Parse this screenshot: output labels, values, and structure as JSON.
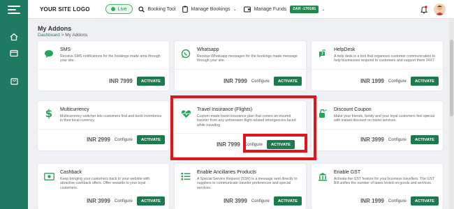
{
  "header": {
    "logo": "YOUR SITE LOGO",
    "live_label": "Live",
    "nav": {
      "booking_tool": "Booking Tool",
      "manage_bookings": "Manage Bookings",
      "manage_funds": "Manage Funds",
      "funds_badge": "ZAR -170181"
    }
  },
  "page": {
    "title": "My Addons",
    "breadcrumb": {
      "home": "Dashboard",
      "separator": ">",
      "current": "My Addons"
    }
  },
  "colors": {
    "sidebar": "#1f7a62",
    "activate": "#1e7a4e",
    "highlight": "#e0151b"
  },
  "addons": [
    {
      "title": "SMS",
      "icon": "chat-bubble-icon",
      "desc": "Receive SMS notifications for the bookings made ama through your site.",
      "price": "INR 7999",
      "configure": "",
      "activate": "ACTIVATE"
    },
    {
      "title": "Whatsapp",
      "icon": "whatsapp-icon",
      "desc": "Receive Whatsapp messages for the bookings made message through your site.",
      "price": "INR 7999",
      "configure": "Configure",
      "activate": "ACTIVATE"
    },
    {
      "title": "HelpDesk",
      "icon": "helpdesk-icon",
      "desc": "A help desk is a tool that organizes customer communication to help businesses respond to customers and support them 24X7",
      "price": "INR 1999",
      "configure": "Configure",
      "activate": "ACTIVATE"
    },
    {
      "title": "Multicurrency",
      "icon": "dollar-icon",
      "desc": "Multicurrency switcher lets customers find and book inventories in their local currency.",
      "price": "INR 2999",
      "configure": "Configure",
      "activate": "ACTIVATE"
    },
    {
      "title": "Travel Insurance (Flights)",
      "icon": "heart-pulse-icon",
      "desc": "Custom-made travel insurance plan that covers an insured traveler from any unforeseen flight-related emergencies faced while traveling",
      "price": "INR 7999",
      "configure": "Configure",
      "activate": "ACTIVATE"
    },
    {
      "title": "Discount Coupon",
      "icon": "coupon-icon",
      "desc": "Make your friends, family and your loyal customers feel special with instant discount on travel services.",
      "price": "INR 3999",
      "configure": "Configure",
      "activate": "ACTIVATE"
    },
    {
      "title": "Cashback",
      "icon": "cashback-icon",
      "desc": "Keep bringing your customers back to your website with attractive cashback offers. Offer rewards to your loyal customers.",
      "price": "INR 3999",
      "configure": "Configure",
      "activate": "ACTIVATE"
    },
    {
      "title": "Enable Ancillaries Products",
      "icon": "list-icon",
      "desc": "A Special Service Request (SSR) is a message sent directly to suppliers to communicate traveler preferences and special services.",
      "price": "INR 3999",
      "configure": "Configure",
      "activate": "ACTIVATE"
    },
    {
      "title": "Enable GST",
      "icon": "bank-icon",
      "desc": "Activate the GST feature for your business travellers. The GST Bill unifies the number of taxes levied on goods and services.",
      "price": "INR 1999",
      "configure": "Configure",
      "activate": "ACTIVATE"
    }
  ]
}
